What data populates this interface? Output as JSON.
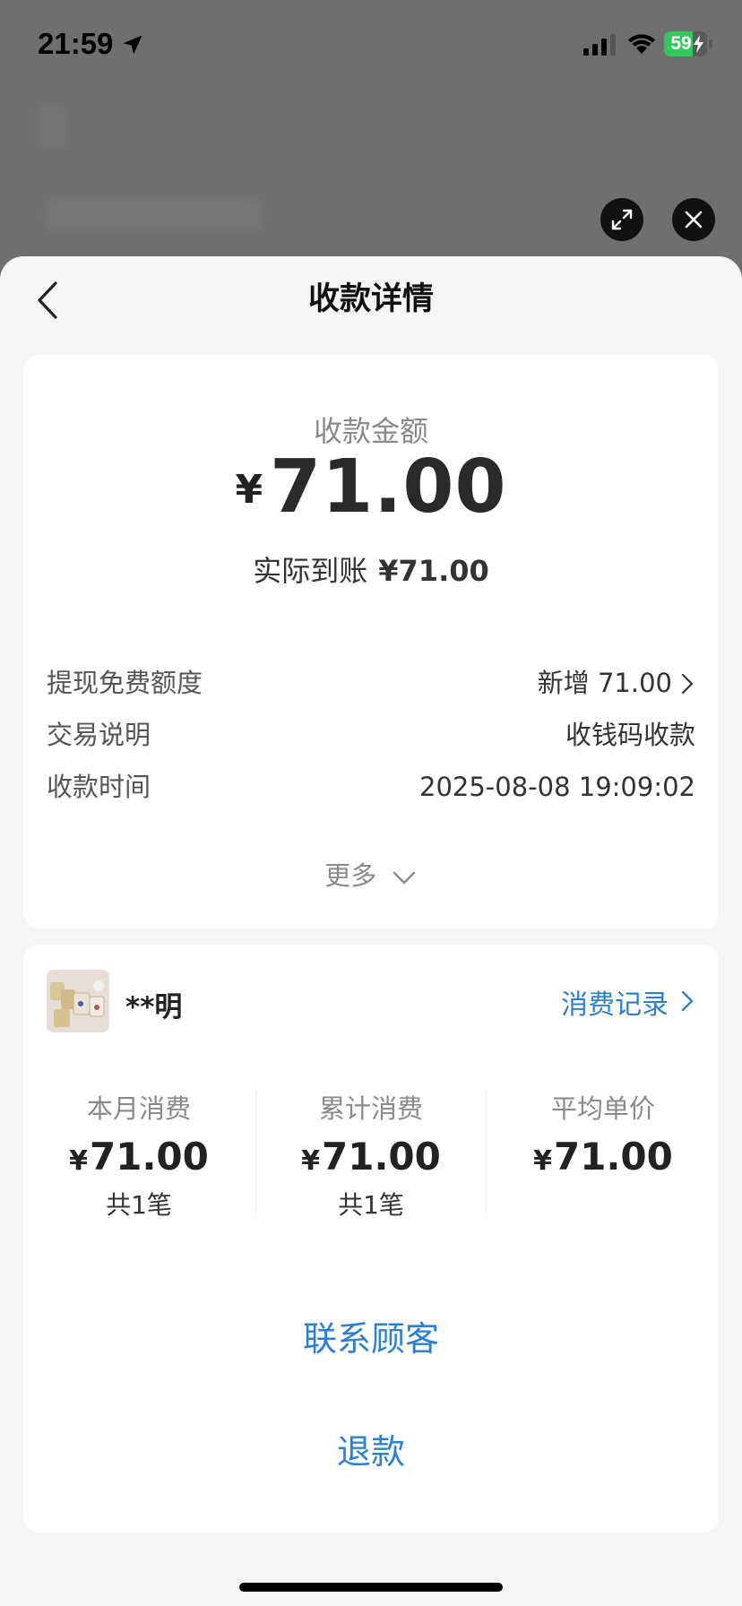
{
  "status_bar": {
    "time": "21:59",
    "battery": "59",
    "battery_color": "#34c759"
  },
  "nav": {
    "title": "收款详情"
  },
  "amount_card": {
    "label": "收款金额",
    "currency": "¥",
    "amount": "71.00",
    "received_label": "实际到账",
    "received_amount": "¥71.00",
    "rows": [
      {
        "label": "提现免费额度",
        "value": "新增 71.00"
      },
      {
        "label": "交易说明",
        "value": "收钱码收款"
      },
      {
        "label": "收款时间",
        "value": "2025-08-08 19:09:02"
      }
    ],
    "more": "更多"
  },
  "customer_card": {
    "name": "**明",
    "records_link": "消费记录",
    "stats": [
      {
        "label": "本月消费",
        "currency": "¥",
        "amount": "71.00",
        "count": "共1笔"
      },
      {
        "label": "累计消费",
        "currency": "¥",
        "amount": "71.00",
        "count": "共1笔"
      },
      {
        "label": "平均单价",
        "currency": "¥",
        "amount": "71.00",
        "count": ""
      }
    ]
  },
  "actions": {
    "contact": "联系顾客",
    "refund": "退款"
  },
  "colors": {
    "accent": "#2d7fd3",
    "overlay": "#6e6e6e",
    "sheet_bg": "#f5f5f5"
  },
  "icons": [
    "location-arrow-icon",
    "signal-icon",
    "wifi-icon",
    "battery-icon",
    "expand-icon",
    "close-icon",
    "back-chevron-icon",
    "chevron-right-icon",
    "chevron-down-icon"
  ]
}
